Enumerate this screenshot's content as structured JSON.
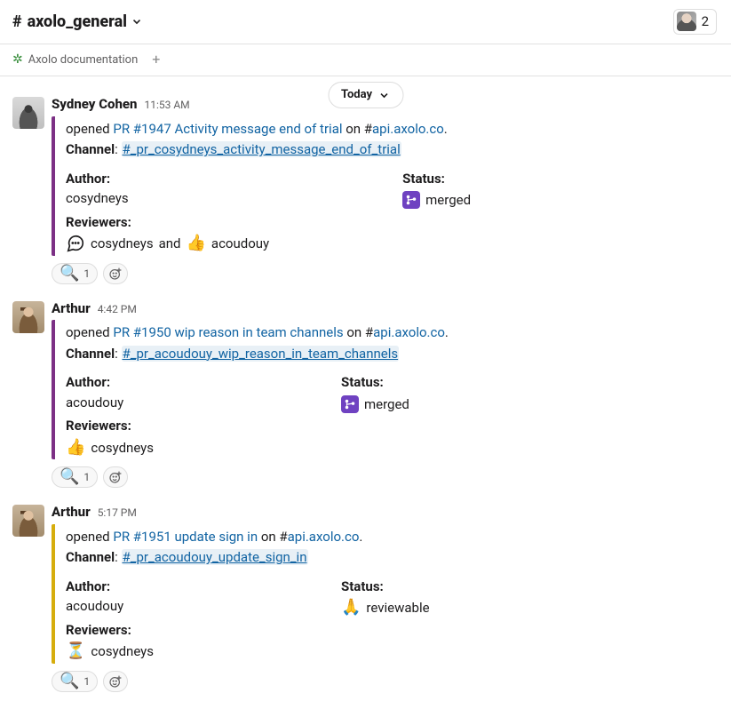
{
  "header": {
    "channel_name": "axolo_general",
    "member_count": "2"
  },
  "bookmarks": {
    "items": [
      {
        "label": "Axolo documentation"
      }
    ]
  },
  "date_divider": "Today",
  "messages": [
    {
      "author": "Sydney Cohen",
      "avatar_class": "sydney",
      "time": "11:53 AM",
      "border": "purple",
      "opened_prefix": "opened ",
      "pr_link": "PR #1947 Activity message end of trial",
      "on_text": " on #",
      "repo": "api.axolo.co",
      "channel_label": "Channel",
      "channel_mention": "#_pr_cosydneys_activity_message_end_of_trial",
      "author_label": "Author:",
      "author_value": "cosydneys",
      "status_label": "Status:",
      "status_value": "merged",
      "status_type": "merged",
      "reviewers_label": "Reviewers:",
      "reviewers": [
        {
          "icon_type": "comment",
          "name": "cosydneys"
        },
        {
          "joiner": "and"
        },
        {
          "icon_type": "thumbsup",
          "name": "acoudouy"
        }
      ],
      "reaction": {
        "emoji": "🔍",
        "count": "1"
      }
    },
    {
      "author": "Arthur",
      "avatar_class": "arthur",
      "time": "4:42 PM",
      "border": "purple",
      "opened_prefix": "opened ",
      "pr_link": "PR #1950 wip reason in team channels",
      "on_text": " on #",
      "repo": "api.axolo.co",
      "channel_label": "Channel",
      "channel_mention": "#_pr_acoudouy_wip_reason_in_team_channels",
      "author_label": "Author:",
      "author_value": "acoudouy",
      "status_label": "Status:",
      "status_value": "merged",
      "status_type": "merged",
      "reviewers_label": "Reviewers:",
      "reviewers": [
        {
          "icon_type": "thumbsup",
          "name": "cosydneys"
        }
      ],
      "reaction": {
        "emoji": "🔍",
        "count": "1"
      }
    },
    {
      "author": "Arthur",
      "avatar_class": "arthur",
      "time": "5:17 PM",
      "border": "yellow",
      "opened_prefix": "opened ",
      "pr_link": "PR #1951 update sign in",
      "on_text": " on #",
      "repo": "api.axolo.co",
      "channel_label": "Channel",
      "channel_mention": "#_pr_acoudouy_update_sign_in",
      "author_label": "Author:",
      "author_value": "acoudouy",
      "status_label": "Status:",
      "status_value": "reviewable",
      "status_type": "reviewable",
      "reviewers_label": "Reviewers:",
      "reviewers": [
        {
          "icon_type": "hourglass",
          "name": "cosydneys"
        }
      ],
      "reaction": {
        "emoji": "🔍",
        "count": "1"
      }
    }
  ]
}
